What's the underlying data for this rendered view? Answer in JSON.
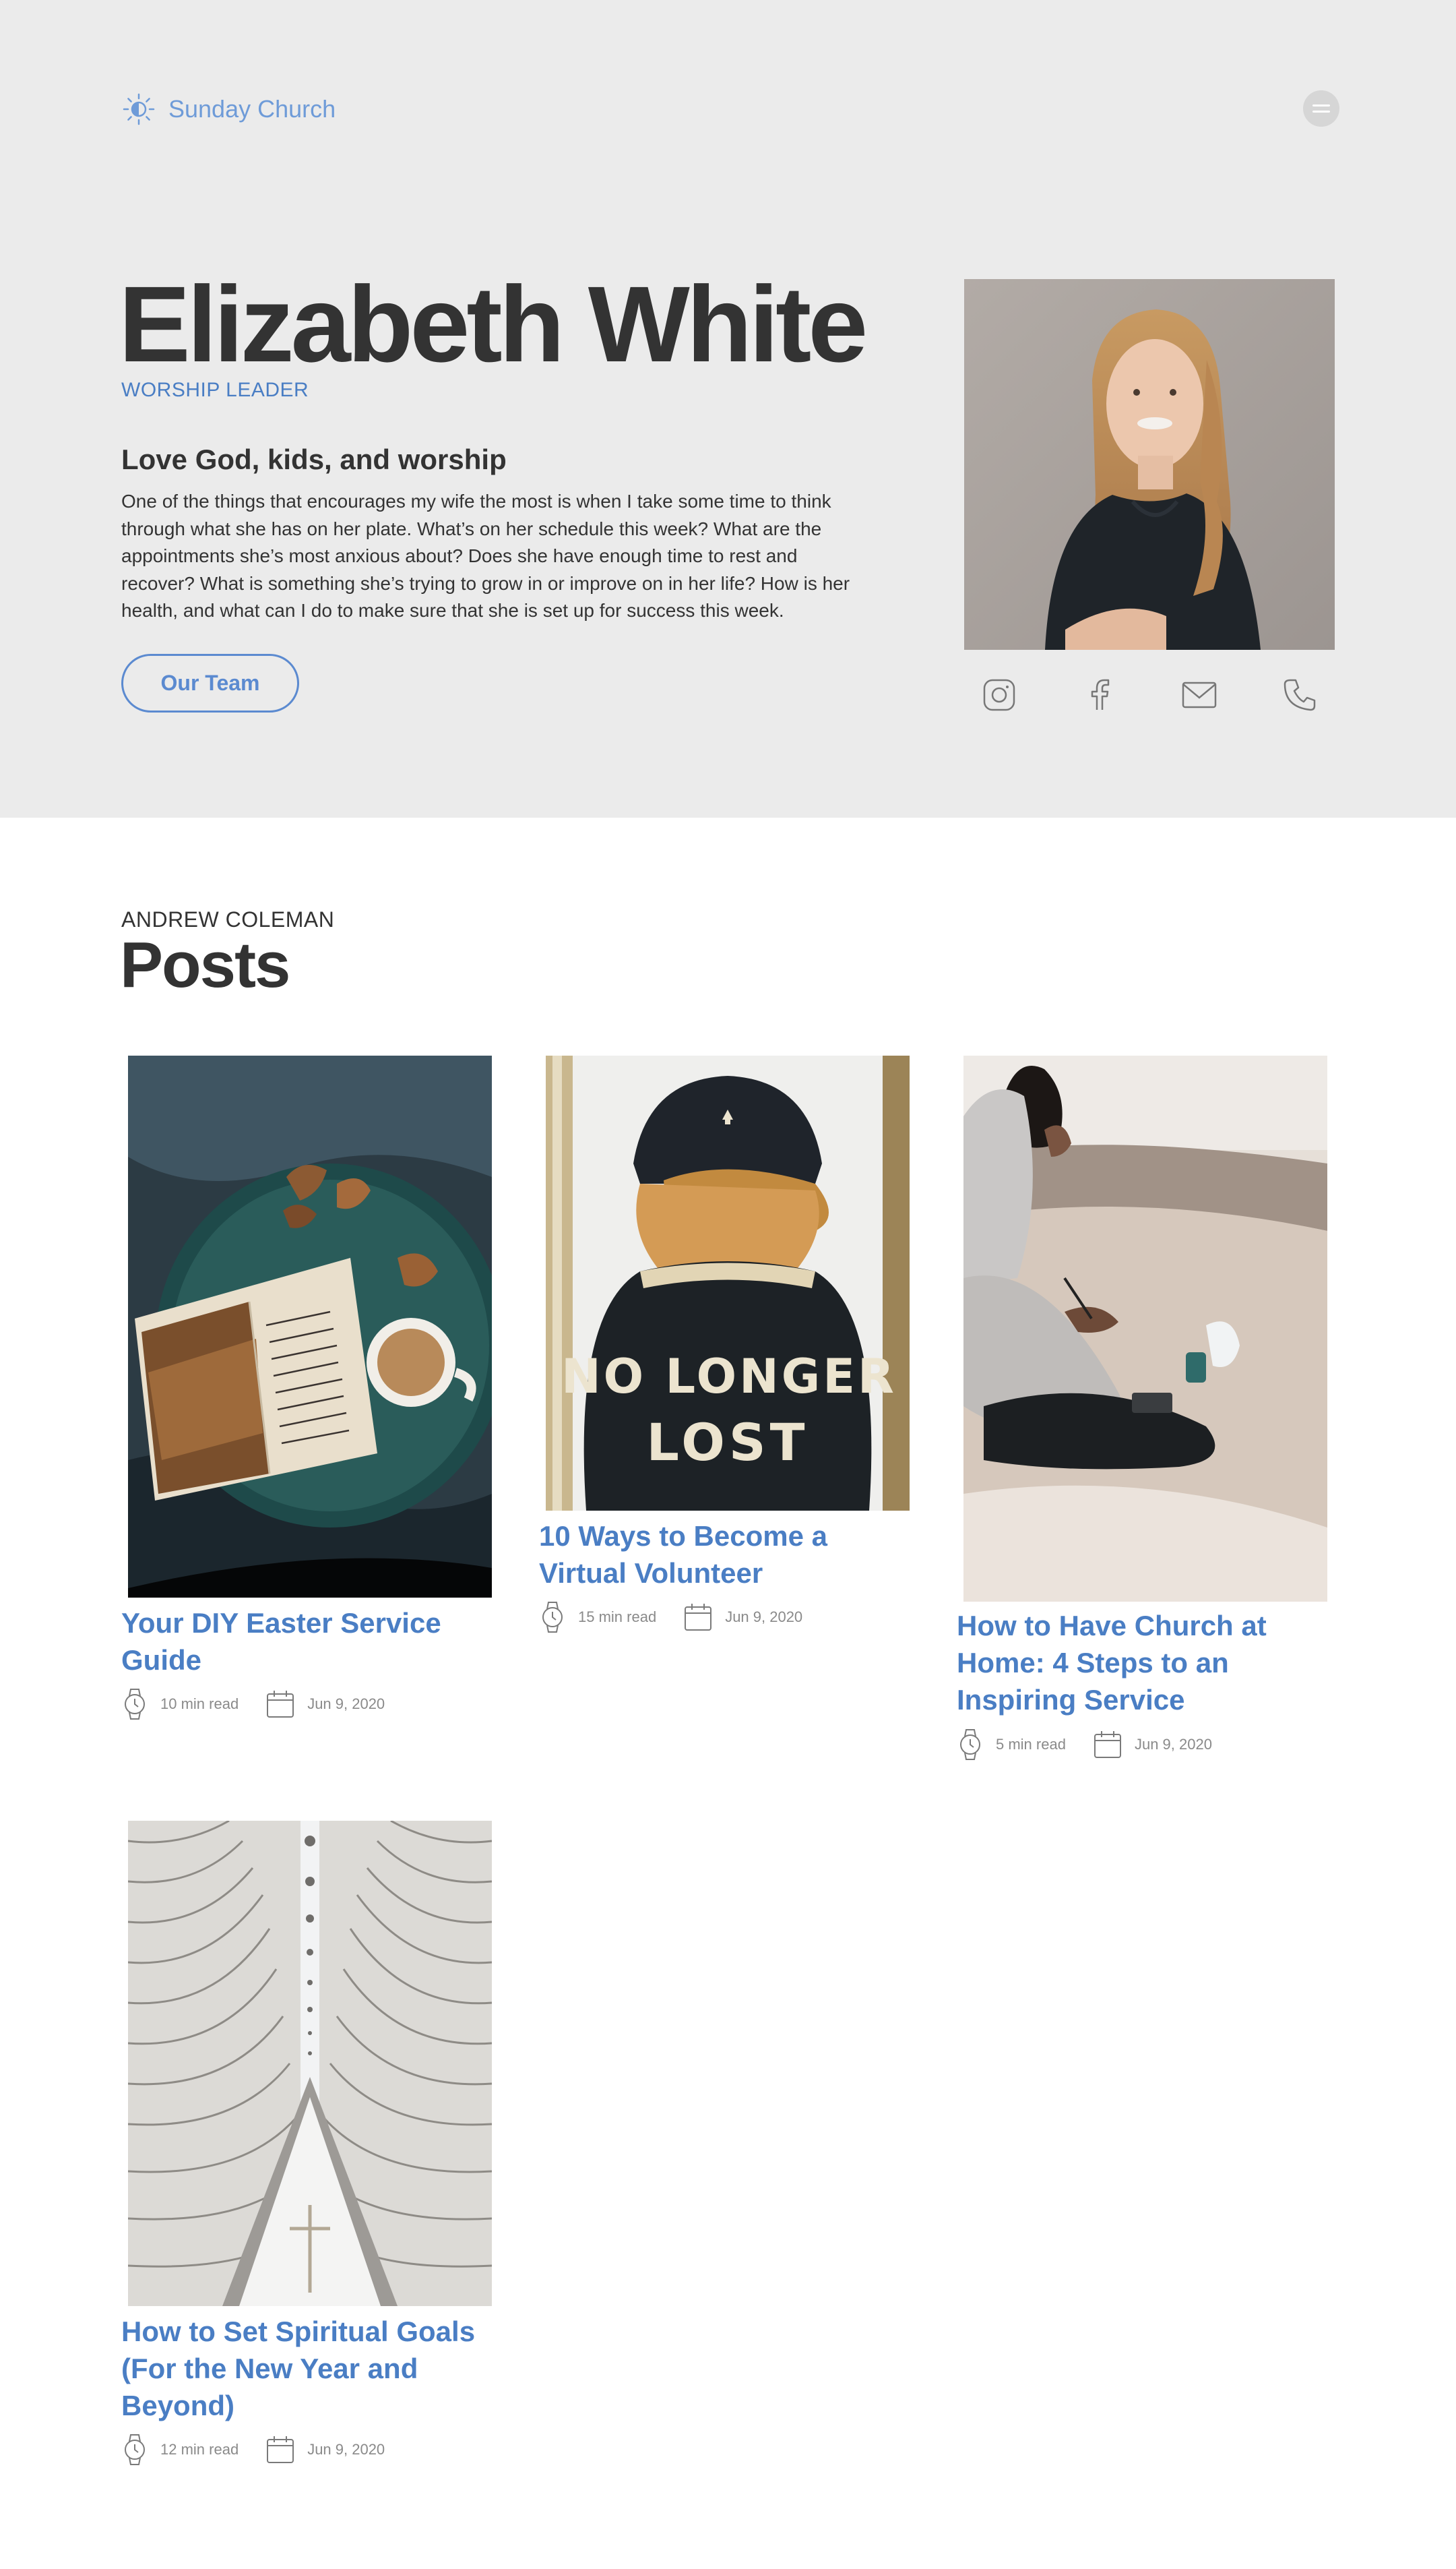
{
  "brand": {
    "name": "Sunday Church",
    "accent": "#4a7ec4",
    "logo_icon": "sun-icon"
  },
  "header": {
    "menu_icon": "hamburger-icon"
  },
  "profile": {
    "name": "Elizabeth White",
    "role": "WORSHIP LEADER",
    "tagline": "Love God, kids, and worship",
    "bio": "One of the things that encourages my wife the most is when I take some time to think through what she has on her plate. What’s on her schedule this week? What are the appointments she’s most anxious about? Does she have enough time to rest and recover? What is something she’s trying to grow in or improve on in her life? How is her health, and what can I do to make sure that she is set up for success this week.",
    "button_label": "Our Team",
    "social_icons": [
      "instagram-icon",
      "facebook-icon",
      "mail-icon",
      "phone-icon"
    ]
  },
  "posts_section": {
    "author": "ANDREW COLEMAN",
    "title": "Posts",
    "posts": [
      {
        "title": "Your DIY Easter Service Guide",
        "read_time": "10 min read",
        "date": "Jun 9, 2020"
      },
      {
        "title": "10 Ways to Become a Virtual Volunteer",
        "read_time": "15 min read",
        "date": "Jun 9, 2020"
      },
      {
        "title": "How to Have Church at Home: 4 Steps to an Inspiring Service",
        "read_time": "5 min read",
        "date": "Jun 9, 2020"
      },
      {
        "title": "How to Set Spiritual Goals (For the New Year and Beyond)",
        "read_time": "12 min read",
        "date": "Jun 9, 2020"
      }
    ],
    "image_text": {
      "jacket_text_1": "NO LONGER",
      "jacket_text_2": "LOST"
    }
  }
}
